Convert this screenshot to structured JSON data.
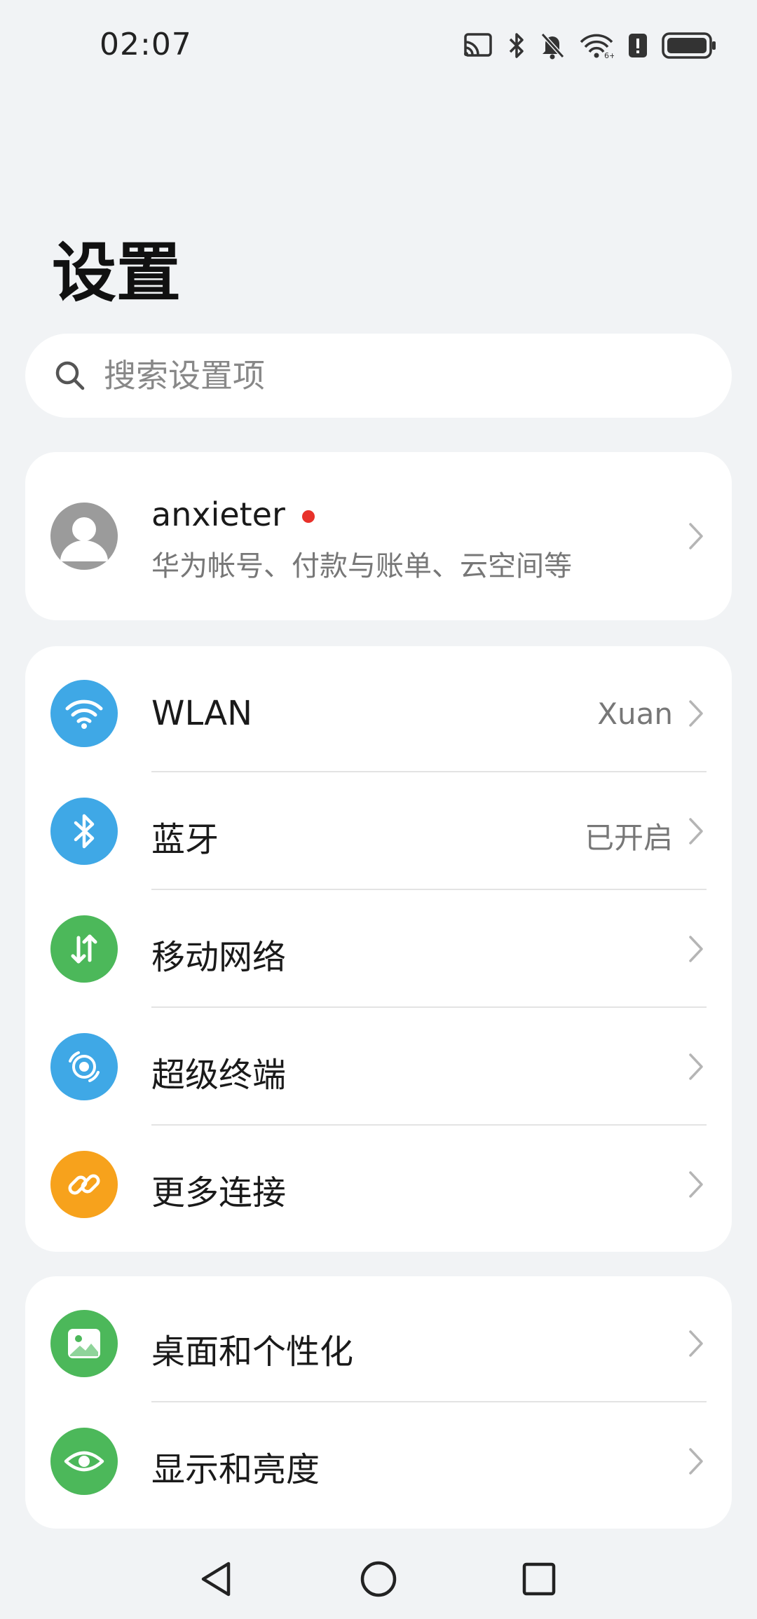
{
  "status_bar": {
    "time": "02:07",
    "icons": [
      "cast-icon",
      "bluetooth-icon",
      "mute-icon",
      "wifi-icon",
      "alert-icon",
      "battery-icon"
    ]
  },
  "title": "设置",
  "search": {
    "placeholder": "搜索设置项"
  },
  "account": {
    "name": "anxieter",
    "subtitle": "华为帐号、付款与账单、云空间等",
    "notification_dot_color": "#e8312a"
  },
  "connectivity": [
    {
      "label": "WLAN",
      "value": "Xuan",
      "icon": "wifi-icon",
      "color": "#3fa8e6"
    },
    {
      "label": "蓝牙",
      "value": "已开启",
      "icon": "bluetooth-icon",
      "color": "#3fa8e6"
    },
    {
      "label": "移动网络",
      "value": "",
      "icon": "mobile-data-icon",
      "color": "#4cb85a"
    },
    {
      "label": "超级终端",
      "value": "",
      "icon": "super-device-icon",
      "color": "#3fa8e6"
    },
    {
      "label": "更多连接",
      "value": "",
      "icon": "link-icon",
      "color": "#f7a21c"
    }
  ],
  "display": [
    {
      "label": "桌面和个性化",
      "icon": "wallpaper-icon",
      "color": "#4cb85a"
    },
    {
      "label": "显示和亮度",
      "icon": "eye-icon",
      "color": "#4cb85a"
    }
  ],
  "nav": [
    "back-icon",
    "home-icon",
    "recents-icon"
  ]
}
